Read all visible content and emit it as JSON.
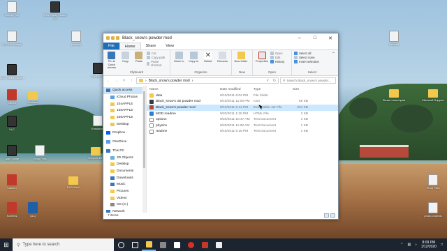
{
  "desktop": {
    "icons": [
      {
        "label": "Google File"
      },
      {
        "label": "GTA Empty Library 2.0"
      },
      {
        "label": "LCD HD Gallery"
      },
      {
        "label": "pic stills"
      },
      {
        "label": "DS7 Media Edition"
      },
      {
        "label": "RAR 2014"
      },
      {
        "label": "Steam"
      },
      {
        "label": "Textures"
      },
      {
        "label": "VLC"
      },
      {
        "label": "Emulators"
      },
      {
        "label": "Jade Game"
      },
      {
        "label": "Launch"
      },
      {
        "label": "DVD MAX"
      },
      {
        "label": "Screens"
      },
      {
        "label": "QLQ"
      },
      {
        "label": "Youtube"
      },
      {
        "label": "Steam Launchpad"
      },
      {
        "label": "Microsoft Support"
      },
      {
        "label": "Temp Files"
      },
      {
        "label": "photo projects"
      },
      {
        "label": "Temp Files"
      },
      {
        "label": "Recycle Bin"
      }
    ]
  },
  "window": {
    "title": "Black_snow's powder mod",
    "ribbon_tabs": [
      "File",
      "Home",
      "Share",
      "View"
    ],
    "groups": {
      "clipboard": {
        "label": "Clipboard",
        "pin": "Pin to Quick access",
        "copy": "Copy",
        "paste": "Paste",
        "cut": "Cut",
        "copy_path": "Copy path",
        "paste_shortcut": "Paste shortcut"
      },
      "organize": {
        "label": "Organize",
        "move_to": "Move to",
        "copy_to": "Copy to",
        "delete": "Delete",
        "rename": "Rename"
      },
      "new": {
        "label": "New",
        "new_folder": "New folder"
      },
      "open": {
        "label": "Open",
        "properties": "Properties",
        "open": "Open",
        "edit": "Edit",
        "history": "History"
      },
      "select": {
        "label": "Select",
        "select_all": "Select all",
        "select_none": "Select none",
        "invert": "Invert selection"
      }
    },
    "address": {
      "path_sep": "›",
      "folder": "Black_snow's powder mod",
      "search_placeholder": "Search Black_snow's powder..."
    },
    "nav": [
      {
        "label": "Quick access",
        "icon": "star-icon",
        "sel": true
      },
      {
        "label": "iCloud Photos",
        "icon": "cloud-icon",
        "sub": true
      },
      {
        "label": "104APPLE",
        "icon": "folder-icon",
        "sub": true
      },
      {
        "label": "105APPLE",
        "icon": "folder-icon",
        "sub": true
      },
      {
        "label": "106APPLE",
        "icon": "folder-icon",
        "sub": true
      },
      {
        "label": "Desktop",
        "icon": "folder-icon",
        "sub": true
      },
      {
        "gap": true
      },
      {
        "label": "Dropbox",
        "icon": "dropbox-icon"
      },
      {
        "gap": true
      },
      {
        "label": "OneDrive",
        "icon": "cloud-icon"
      },
      {
        "gap": true
      },
      {
        "label": "This PC",
        "icon": "pc-icon"
      },
      {
        "label": "3D Objects",
        "icon": "cube-icon",
        "sub": true
      },
      {
        "label": "Desktop",
        "icon": "folder-icon",
        "sub": true
      },
      {
        "label": "Documents",
        "icon": "folder-icon",
        "sub": true
      },
      {
        "label": "Downloads",
        "icon": "download-icon",
        "sub": true
      },
      {
        "label": "Music",
        "icon": "music-icon",
        "sub": true
      },
      {
        "label": "Pictures",
        "icon": "folder-icon",
        "sub": true
      },
      {
        "label": "Videos",
        "icon": "folder-icon",
        "sub": true
      },
      {
        "label": "OS (C:)",
        "icon": "drive-icon",
        "sub": true
      },
      {
        "label": "Network",
        "icon": "network-icon"
      }
    ],
    "columns": {
      "name": "Name",
      "date": "Date modified",
      "type": "Type",
      "size": "Size"
    },
    "files": [
      {
        "name": "data",
        "date": "9/10/2011 6:04 PM",
        "type": "File folder",
        "size": "",
        "icon": "folder"
      },
      {
        "name": "Black_snow's 3D powder mod",
        "date": "9/10/2011 11:09 PM",
        "type": "Icon",
        "size": "65 KB",
        "icon": "mod"
      },
      {
        "name": "Black_snow's powder mod",
        "date": "9/10/2011 6:14 PM",
        "type": "Executable Jar File",
        "size": "204 KB",
        "icon": "jar",
        "sel": true
      },
      {
        "name": "MOD readme",
        "date": "9/20/2011 1:25 PM",
        "type": "HTML File",
        "size": "3 KB",
        "icon": "html"
      },
      {
        "name": "options",
        "date": "9/20/2011 10:47 AM",
        "type": "Text Document",
        "size": "1 KB",
        "icon": "txt"
      },
      {
        "name": "physics",
        "date": "9/20/2011 11:28 AM",
        "type": "Text Document",
        "size": "1 KB",
        "icon": "txt"
      },
      {
        "name": "readme",
        "date": "9/10/2011 6:15 PM",
        "type": "Text Document",
        "size": "1 KB",
        "icon": "txt"
      }
    ],
    "status": "7 items"
  },
  "taskbar": {
    "search_placeholder": "Type here to search",
    "time": "8:09 PM",
    "date": "1/12/2020"
  }
}
